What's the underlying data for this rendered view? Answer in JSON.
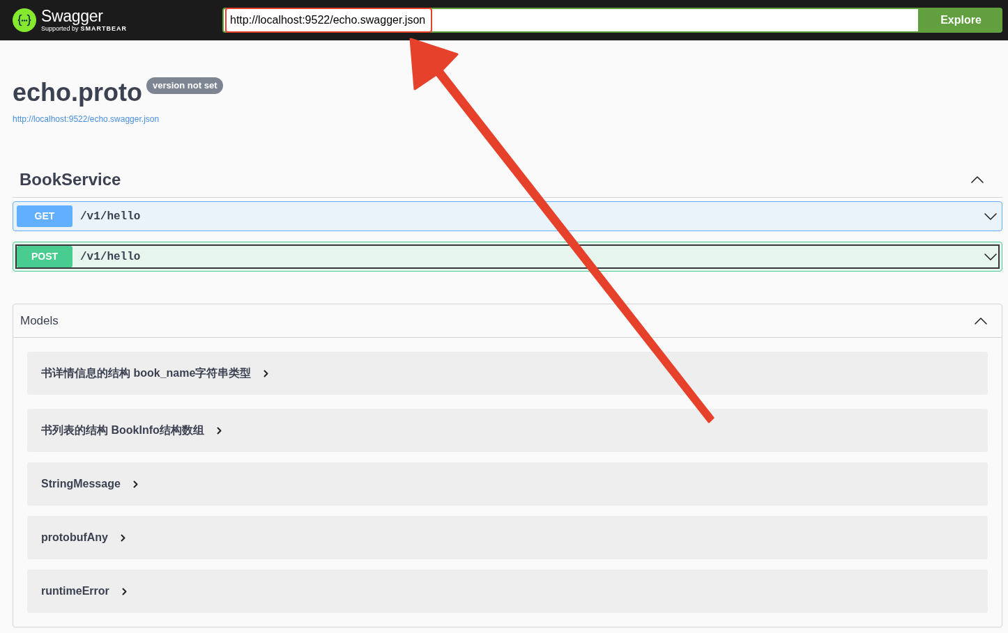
{
  "top_bar": {
    "brand": "Swagger",
    "tagline_prefix": "Supported by",
    "tagline_brand": "SMARTBEAR",
    "url_field": {
      "value": "http://localhost:9522/echo.swagger.json",
      "highlighted": true
    },
    "explore_button": "Explore"
  },
  "info": {
    "title": "echo.proto",
    "version": "version not set",
    "spec_url": "http://localhost:9522/echo.swagger.json"
  },
  "tags": [
    {
      "name": "BookService",
      "expanded": true,
      "operations": [
        {
          "method": "GET",
          "path": "/v1/hello",
          "color": "#61affe",
          "expanded": false,
          "focused": false
        },
        {
          "method": "POST",
          "path": "/v1/hello",
          "color": "#49cc90",
          "expanded": false,
          "focused": true
        }
      ]
    }
  ],
  "models": {
    "title": "Models",
    "expanded": true,
    "items": [
      {
        "name": "书详情信息的结构 book_name字符串类型",
        "expanded": false
      },
      {
        "name": "书列表的结构 BookInfo结构数组",
        "expanded": false
      },
      {
        "name": "StringMessage",
        "expanded": false
      },
      {
        "name": "protobufAny",
        "expanded": false
      },
      {
        "name": "runtimeError",
        "expanded": false
      }
    ]
  },
  "annotations": [
    {
      "kind": "arrow"
    }
  ]
}
